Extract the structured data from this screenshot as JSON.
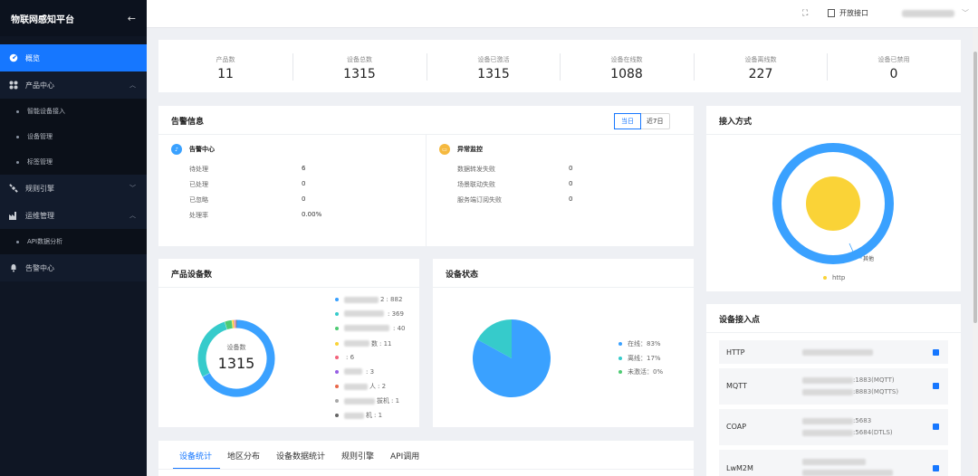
{
  "sidebar": {
    "brand": "物联网感知平台",
    "collapse_icon": "arrow-left-icon",
    "items": [
      {
        "label": "概览",
        "icon": "dashboard-icon"
      },
      {
        "label": "产品中心",
        "icon": "grid-icon"
      },
      {
        "label": "智能设备接入"
      },
      {
        "label": "设备管理"
      },
      {
        "label": "标签管理"
      },
      {
        "label": "规则引擎",
        "icon": "satellite-icon"
      },
      {
        "label": "运维管理",
        "icon": "factory-icon"
      },
      {
        "label": "API数据分析"
      },
      {
        "label": "告警中心",
        "icon": "bell-icon"
      }
    ]
  },
  "header": {
    "api_label": "开放接口"
  },
  "stats": [
    {
      "label": "产品数",
      "value": "11"
    },
    {
      "label": "设备总数",
      "value": "1315"
    },
    {
      "label": "设备已激活",
      "value": "1315"
    },
    {
      "label": "设备在线数",
      "value": "1088"
    },
    {
      "label": "设备离线数",
      "value": "227"
    },
    {
      "label": "设备已禁用",
      "value": "0"
    }
  ],
  "alerts": {
    "title": "告警信息",
    "toggle": [
      "当日",
      "近7日"
    ],
    "center": {
      "title": "告警中心",
      "rows": [
        {
          "label": "待处理",
          "value": "6"
        },
        {
          "label": "已处理",
          "value": "0"
        },
        {
          "label": "已忽略",
          "value": "0"
        },
        {
          "label": "处理率",
          "value": "0.00%"
        }
      ]
    },
    "monitor": {
      "title": "异常监控",
      "rows": [
        {
          "label": "数据转发失败",
          "value": "0"
        },
        {
          "label": "场景联动失败",
          "value": "0"
        },
        {
          "label": "服务端订阅失败",
          "value": "0"
        }
      ]
    }
  },
  "access": {
    "title": "接入方式",
    "chart_data": {
      "type": "pie",
      "categories": [
        "http",
        "其他"
      ],
      "values": [
        100,
        0
      ],
      "colors": [
        "#fad337",
        "#3aa1ff"
      ],
      "legend": "bottom"
    },
    "callout": "其他",
    "legend_label": "http"
  },
  "product_devices": {
    "title": "产品设备数",
    "center_label": "设备数",
    "center_value": "1315",
    "chart_data": {
      "type": "pie",
      "values": [
        882,
        369,
        40,
        11,
        6,
        3,
        2,
        1,
        1
      ],
      "colors": [
        "#3aa1ff",
        "#36cbcb",
        "#4ecb73",
        "#fad337",
        "#f2637b",
        "#975fe4",
        "#e8684a",
        "#a8a8a8",
        "#666666"
      ],
      "legend": "right"
    },
    "legend_values": [
      ": 882",
      ": 369",
      ": 40",
      ": 11",
      ": 6",
      ": 3",
      ": 2",
      ": 1",
      ": 1"
    ],
    "legend_fragments": [
      "2",
      "",
      "",
      "数",
      "",
      "",
      "人",
      "拔机",
      "机"
    ]
  },
  "device_status": {
    "title": "设备状态",
    "chart_data": {
      "type": "pie",
      "categories": [
        "在线",
        "离线",
        "未激活"
      ],
      "values": [
        83,
        17,
        0
      ],
      "colors": [
        "#3aa1ff",
        "#36cbcb",
        "#4ecb73"
      ],
      "legend": "right"
    },
    "legend_labels": [
      "在线：83%",
      "离线：17%",
      "未激活：0%"
    ]
  },
  "tabs": [
    "设备统计",
    "地区分布",
    "设备数据统计",
    "规则引擎",
    "API调用"
  ],
  "access_points": {
    "title": "设备接入点",
    "items": [
      {
        "name": "HTTP",
        "lines": [
          ""
        ]
      },
      {
        "name": "MQTT",
        "lines": [
          ":1883(MQTT)",
          ":8883(MQTTS)"
        ]
      },
      {
        "name": "COAP",
        "lines": [
          ":5683",
          ":5684(DTLS)"
        ]
      },
      {
        "name": "LwM2M",
        "lines": [
          "",
          ""
        ]
      }
    ]
  }
}
